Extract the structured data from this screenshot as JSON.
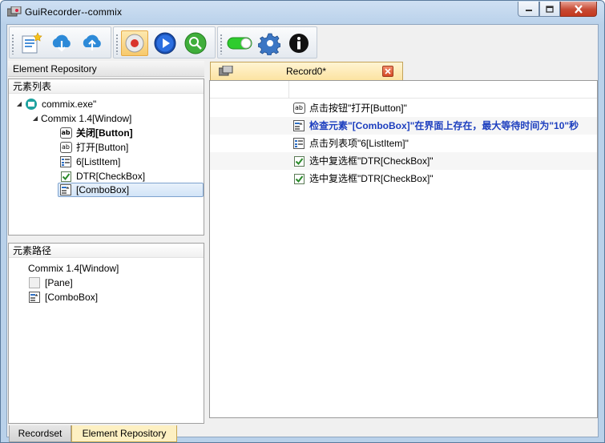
{
  "window": {
    "title": "GuiRecorder--commix"
  },
  "toolbar": {
    "buttons": [
      {
        "name": "new-script-icon"
      },
      {
        "name": "download-cloud-icon"
      },
      {
        "name": "upload-cloud-icon"
      },
      {
        "name": "record-icon"
      },
      {
        "name": "play-icon"
      },
      {
        "name": "inspect-icon"
      },
      {
        "name": "toggle-icon"
      },
      {
        "name": "settings-icon"
      },
      {
        "name": "info-icon"
      }
    ]
  },
  "left": {
    "header": "Element Repository",
    "element_list": {
      "title": "元素列表",
      "items": [
        {
          "label": "commix.exe\"",
          "level": 0
        },
        {
          "label": "Commix 1.4[Window]",
          "level": 1
        },
        {
          "label": "关闭[Button]",
          "level": 2,
          "bold": true
        },
        {
          "label": "打开[Button]",
          "level": 2
        },
        {
          "label": "6[ListItem]",
          "level": 2
        },
        {
          "label": "DTR[CheckBox]",
          "level": 2
        },
        {
          "label": "[ComboBox]",
          "level": 2,
          "selected": true
        }
      ]
    },
    "element_path": {
      "title": "元素路径",
      "items": [
        {
          "label": "Commix 1.4[Window]"
        },
        {
          "label": "[Pane]"
        },
        {
          "label": "[ComboBox]"
        }
      ]
    },
    "tabs": {
      "recordset": "Recordset",
      "element_repository": "Element Repository"
    }
  },
  "editor": {
    "tab_label": "Record0*",
    "steps": [
      {
        "text": "点击按钮\"打开[Button]\"",
        "icon": "button-icon"
      },
      {
        "text": "检查元素\"[ComboBox]\"在界面上存在，最大等待时间为\"10\"秒",
        "icon": "combobox-icon",
        "highlight": true
      },
      {
        "text": "点击列表项\"6[ListItem]\"",
        "icon": "listitem-icon"
      },
      {
        "text": "选中复选框\"DTR[CheckBox]\"",
        "icon": "checkbox-icon"
      },
      {
        "text": "选中复选框\"DTR[CheckBox]\"",
        "icon": "checkbox-icon"
      }
    ]
  },
  "colors": {
    "highlight_text": "#1d3fbf",
    "active_tab": "#fce3a1",
    "toggle_on": "#2ecc2e"
  }
}
